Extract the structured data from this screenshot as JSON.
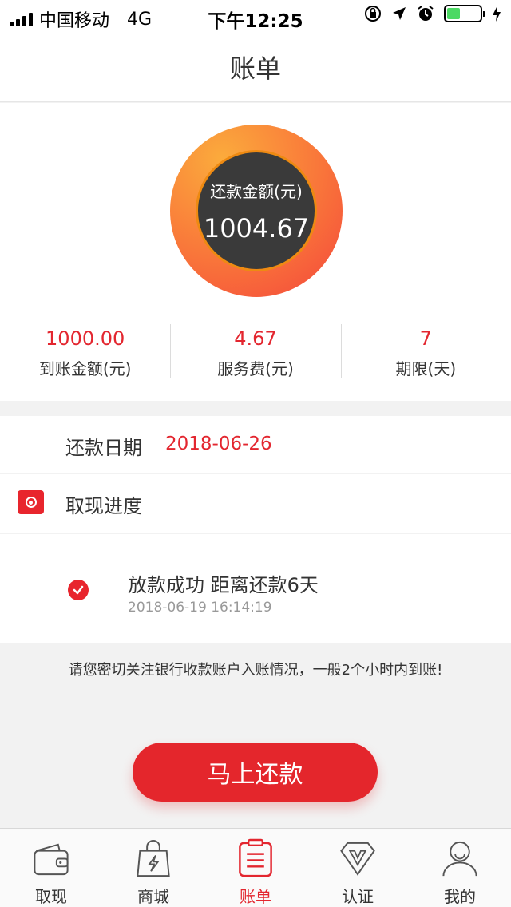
{
  "status_bar": {
    "carrier": "中国移动",
    "network": "4G",
    "time": "下午12:25"
  },
  "nav": {
    "title": "账单"
  },
  "summary": {
    "ring_label": "还款金额(元)",
    "ring_value": "1004.67",
    "stats": [
      {
        "value": "1000.00",
        "label": "到账金额(元)"
      },
      {
        "value": "4.67",
        "label": "服务费(元)"
      },
      {
        "value": "7",
        "label": "期限(天)"
      }
    ]
  },
  "repay_date": {
    "label": "还款日期",
    "value": "2018-06-26"
  },
  "progress": {
    "label": "取现进度"
  },
  "loan_status": {
    "title": "放款成功 距离还款6天",
    "time": "2018-06-19 16:14:19"
  },
  "notice": "请您密切关注银行收款账户入账情况，一般2个小时内到账!",
  "repay_button": "马上还款",
  "tabs": [
    {
      "label": "取现",
      "icon": "wallet-icon",
      "active": false
    },
    {
      "label": "商城",
      "icon": "shopping-bag-icon",
      "active": false
    },
    {
      "label": "账单",
      "icon": "bill-icon",
      "active": true
    },
    {
      "label": "认证",
      "icon": "verify-icon",
      "active": false
    },
    {
      "label": "我的",
      "icon": "user-icon",
      "active": false
    }
  ],
  "colors": {
    "accent": "#e3262f",
    "ring_start": "#fbab3c",
    "ring_end": "#f4463c",
    "ring_center": "#3a3a3a"
  }
}
